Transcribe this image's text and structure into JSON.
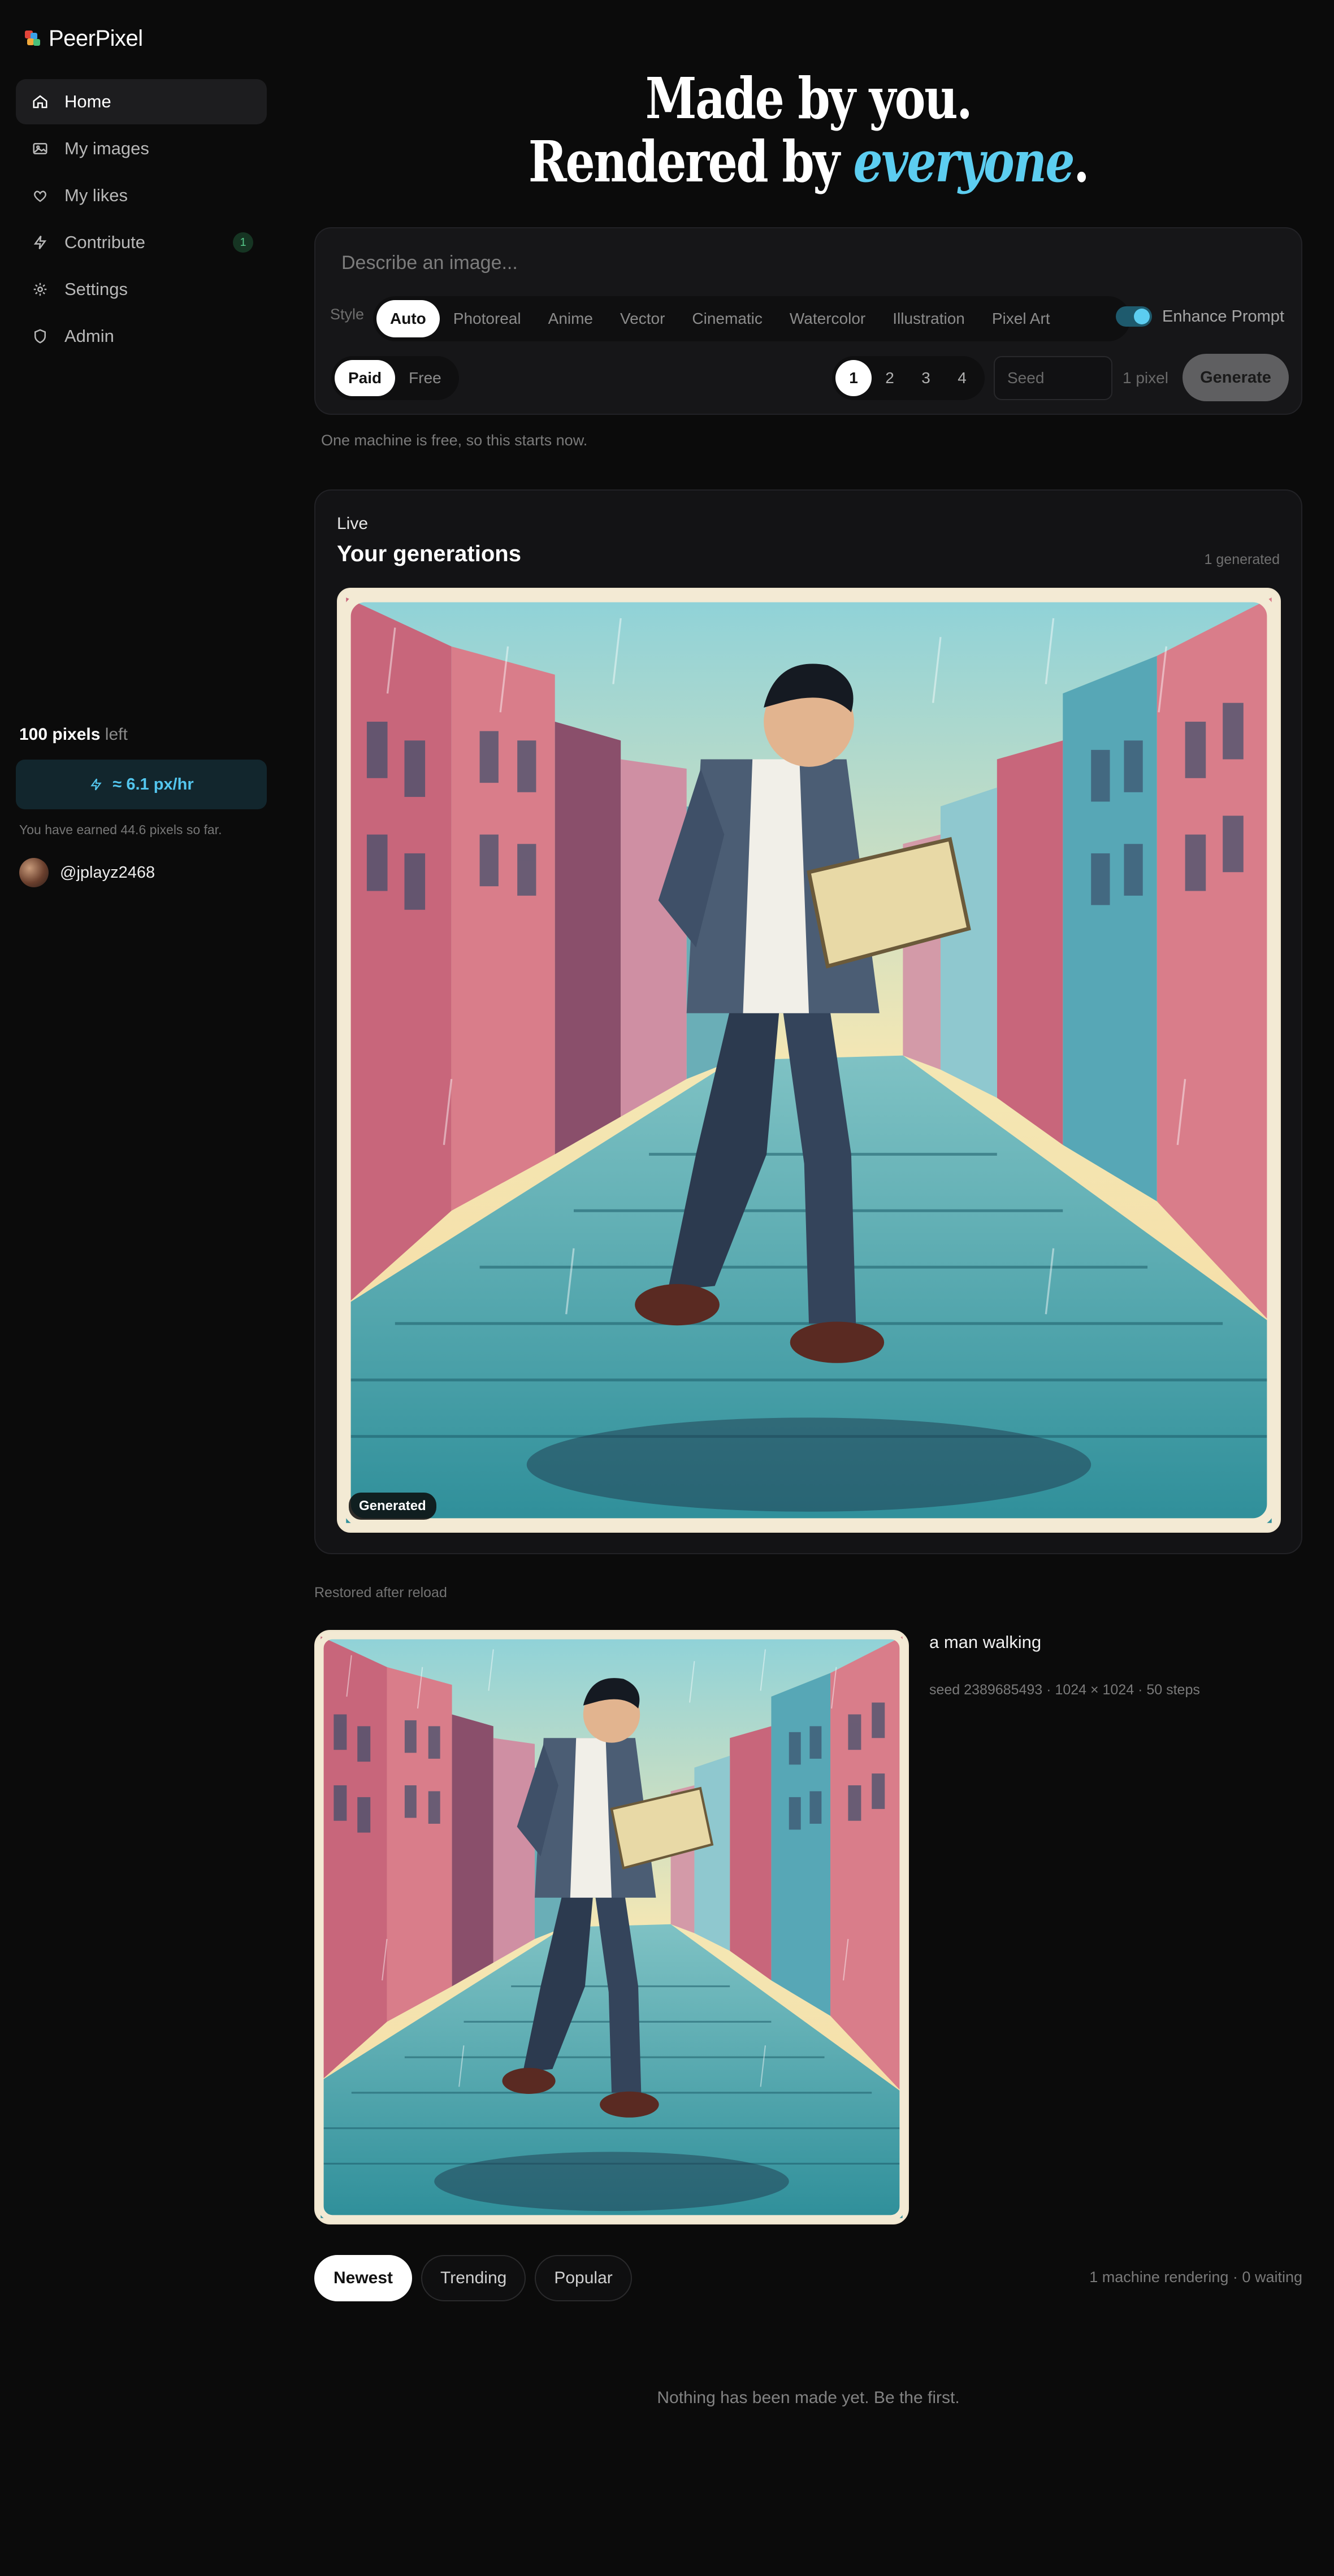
{
  "brand": {
    "name": "PeerPixel",
    "colors": {
      "accent": "#5ccdf0",
      "logo": [
        "#e2453b",
        "#3aa0e8",
        "#f2a93b",
        "#49c07a"
      ]
    }
  },
  "sidebar": {
    "items": [
      {
        "label": "Home",
        "icon": "home-icon",
        "active": true
      },
      {
        "label": "My images",
        "icon": "image-icon"
      },
      {
        "label": "My likes",
        "icon": "heart-icon"
      },
      {
        "label": "Contribute",
        "icon": "bolt-icon",
        "badge": "1"
      },
      {
        "label": "Settings",
        "icon": "settings-icon"
      },
      {
        "label": "Admin",
        "icon": "shield-icon"
      }
    ],
    "pixels_value": "100 pixels",
    "pixels_suffix": "left",
    "rate": "≈ 6.1 px/hr",
    "earned": "You have earned 44.6 pixels so far.",
    "username": "@jplayz2468"
  },
  "hero": {
    "line1": "Made by you.",
    "line2_prefix": "Rendered by ",
    "line2_em": "everyone",
    "line2_suffix": "."
  },
  "compose": {
    "placeholder": "Describe an image...",
    "style_label": "Style",
    "styles": [
      "Auto",
      "Photoreal",
      "Anime",
      "Vector",
      "Cinematic",
      "Watercolor",
      "Illustration",
      "Pixel Art"
    ],
    "selected_style": "Auto",
    "enhance_label": "Enhance Prompt",
    "enhance_on": true,
    "modes": [
      "Paid",
      "Free"
    ],
    "selected_mode": "Paid",
    "counts": [
      "1",
      "2",
      "3",
      "4"
    ],
    "selected_count": "1",
    "seed_placeholder": "Seed",
    "cost": "1 pixel",
    "generate_label": "Generate",
    "hint": "One machine is free, so this starts now."
  },
  "live": {
    "label": "Live",
    "title": "Your generations",
    "count": "1 generated",
    "badge": "Generated"
  },
  "restored": {
    "label": "Restored after reload",
    "prompt": "a man walking",
    "meta": "seed 2389685493 · 1024 × 1024 · 50 steps"
  },
  "feed": {
    "tabs": [
      "Newest",
      "Trending",
      "Popular"
    ],
    "selected_tab": "Newest",
    "queue": "1 machine rendering · 0 waiting",
    "empty": "Nothing has been made yet. Be the first."
  }
}
